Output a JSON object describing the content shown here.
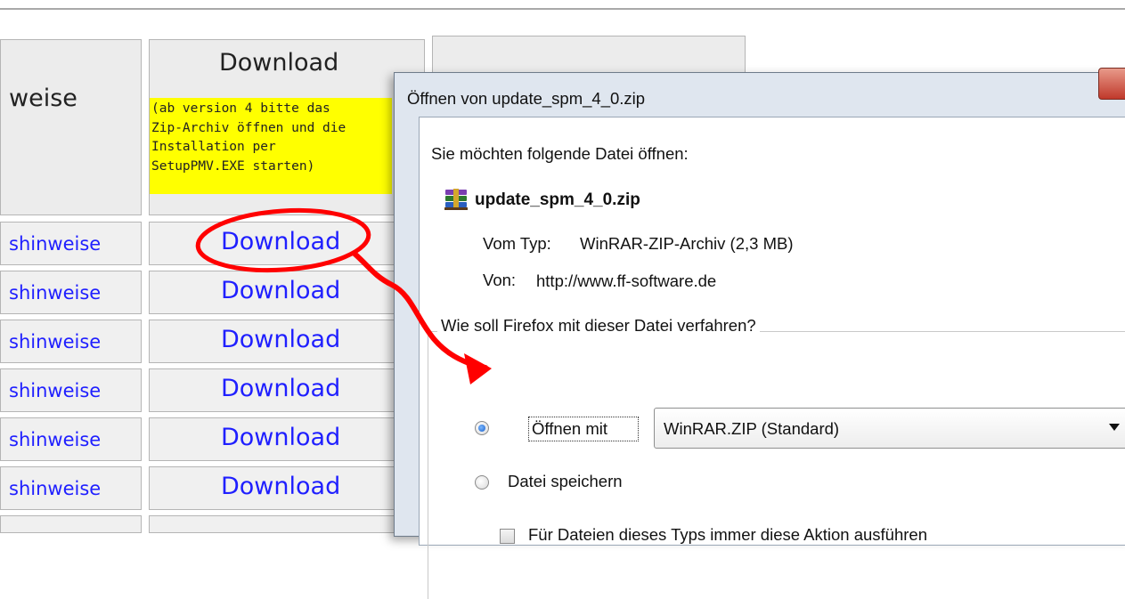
{
  "table": {
    "header_left": "weise",
    "header_download": "Download",
    "note_lines": [
      "(ab version 4 bitte das",
      "Zip-Archiv öffnen und die",
      "Installation per",
      "SetupPMV.EXE starten)"
    ],
    "rows": [
      {
        "left": "shinweise",
        "download": "Download"
      },
      {
        "left": "shinweise",
        "download": "Download"
      },
      {
        "left": "shinweise",
        "download": "Download"
      },
      {
        "left": "shinweise",
        "download": "Download"
      },
      {
        "left": "shinweise",
        "download": "Download"
      },
      {
        "left": "shinweise",
        "download": "Download"
      }
    ],
    "highlight_color": "#ffff00",
    "link_color": "#1f1fff"
  },
  "dialog": {
    "title": "Öffnen von update_spm_4_0.zip",
    "prompt": "Sie möchten folgende Datei öffnen:",
    "filename": "update_spm_4_0.zip",
    "file_icon": "winrar-archive-icon",
    "type_label": "Vom Typ:",
    "type_value": "WinRAR-ZIP-Archiv (2,3 MB)",
    "from_label": "Von:",
    "from_value": "http://www.ff-software.de",
    "question": "Wie soll Firefox mit dieser Datei verfahren?",
    "open_with_label": "Öffnen mit",
    "open_with_value": "WinRAR.ZIP (Standard)",
    "save_label": "Datei speichern",
    "always_label": "Für Dateien dieses Typs immer diese Aktion ausführen",
    "selected_option": "open_with",
    "always_checked": false
  },
  "annotation_color": "#ff0000"
}
